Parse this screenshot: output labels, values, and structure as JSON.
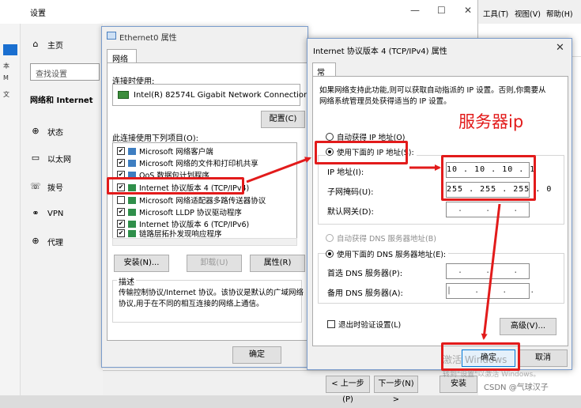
{
  "settings": {
    "title": "设置",
    "home": "主页",
    "search_placeholder": "查找设置",
    "section": "网络和 Internet",
    "nav": [
      "状态",
      "以太网",
      "拨号",
      "VPN",
      "代理"
    ],
    "left_strip": [
      "文",
      "本",
      "M",
      "文"
    ]
  },
  "explorer": {
    "menus": [
      "工具(T)",
      "视图(V)",
      "帮助(H)"
    ]
  },
  "eth": {
    "title": "Ethernet0 属性",
    "tab": "网络",
    "connect_using": "连接时使用:",
    "adapter": "Intel(R) 82574L Gigabit Network Connection",
    "configure": "配置(C)",
    "items_label": "此连接使用下列项目(O):",
    "items": [
      {
        "label": "Microsoft 网络客户端",
        "checked": true
      },
      {
        "label": "Microsoft 网络的文件和打印机共享",
        "checked": true
      },
      {
        "label": "QoS 数据包计划程序",
        "checked": true
      },
      {
        "label": "Internet 协议版本 4 (TCP/IPv4)",
        "checked": true
      },
      {
        "label": "Microsoft 网络适配器多路传送器协议",
        "checked": false
      },
      {
        "label": "Microsoft LLDP 协议驱动程序",
        "checked": true
      },
      {
        "label": "Internet 协议版本 6 (TCP/IPv6)",
        "checked": true
      },
      {
        "label": "链路层拓扑发现响应程序",
        "checked": true
      }
    ],
    "install": "安装(N)...",
    "uninstall": "卸载(U)",
    "properties": "属性(R)",
    "desc_title": "描述",
    "desc_text": "传输控制协议/Internet 协议。该协议是默认的广域网络协议,用于在不同的相互连接的网络上通信。",
    "ok": "确定"
  },
  "ipv4": {
    "title": "Internet 协议版本 4 (TCP/IPv4) 属性",
    "tab": "常规",
    "info": "如果网络支持此功能,则可以获取自动指派的 IP 设置。否则,你需要从网络系统管理员处获得适当的 IP 设置。",
    "auto_ip": "自动获得 IP 地址(O)",
    "manual_ip": "使用下面的 IP 地址(S):",
    "ip_label": "IP 地址(I):",
    "ip_value": "10 . 10 . 10 . 1",
    "mask_label": "子网掩码(U):",
    "mask_value": "255 . 255 . 255 . 0",
    "gateway_label": "默认网关(D):",
    "gateway_value": "  .    .    .  ",
    "auto_dns": "自动获得 DNS 服务器地址(B)",
    "manual_dns": "使用下面的 DNS 服务器地址(E):",
    "dns1_label": "首选 DNS 服务器(P):",
    "dns1_value": "  .    .    .  ",
    "dns2_label": "备用 DNS 服务器(A):",
    "dns2_value": "|    .    .    .  ",
    "validate": "退出时验证设置(L)",
    "advanced": "高级(V)...",
    "ok": "确定",
    "cancel": "取消"
  },
  "annotation": {
    "server_ip": "服务器ip"
  },
  "wizard": {
    "back": "< 上一步(P)",
    "next": "下一步(N) >",
    "install": "安装"
  },
  "watermark": {
    "activate": "激活 Windows",
    "goto": "转到\"设置\"以激活 Windows。",
    "csdn": "CSDN @气球汉子"
  },
  "colors": {
    "highlight_red": "#e21b1b",
    "focus_blue": "#0078d7"
  }
}
